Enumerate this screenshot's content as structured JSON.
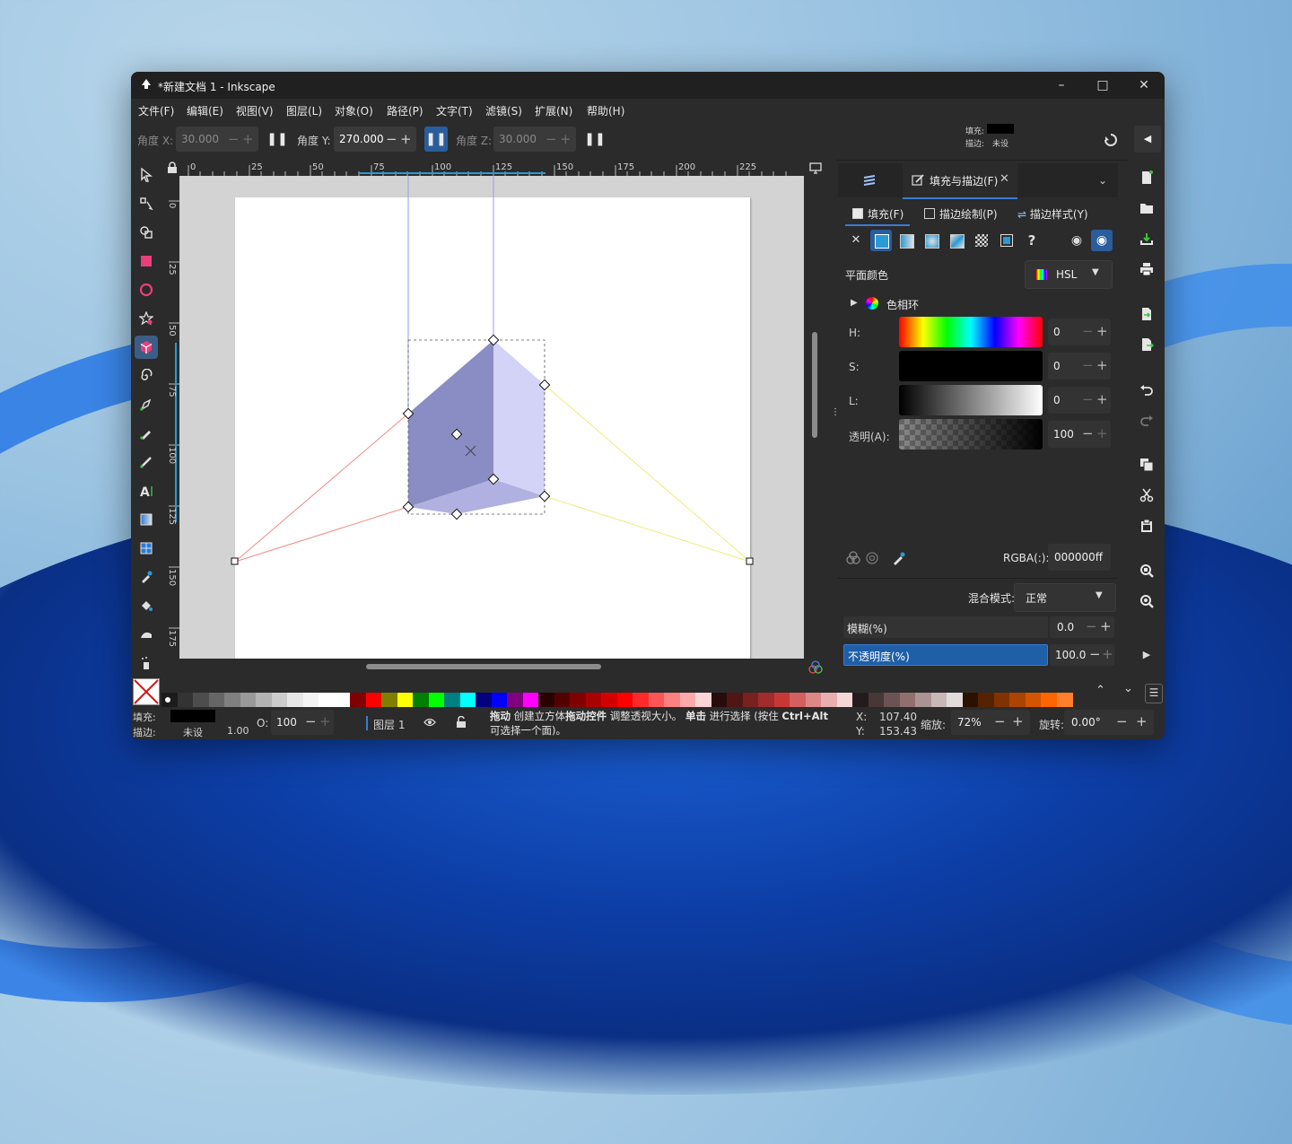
{
  "window": {
    "title": "*新建文档 1 - Inkscape"
  },
  "menu": [
    "文件(F)",
    "编辑(E)",
    "视图(V)",
    "图层(L)",
    "对象(O)",
    "路径(P)",
    "文字(T)",
    "滤镜(S)",
    "扩展(N)",
    "帮助(H)"
  ],
  "toolctl": {
    "angle_x_label": "角度 X:",
    "angle_x": "30.000",
    "angle_y_label": "角度 Y:",
    "angle_y": "270.000",
    "angle_z_label": "角度 Z:",
    "angle_z": "30.000",
    "fill_label": "填充:",
    "stroke_label": "描边:",
    "stroke_value": "未设"
  },
  "ruler": {
    "h": [
      "0",
      "25",
      "50",
      "75",
      "100",
      "125",
      "150",
      "175",
      "200",
      "225"
    ],
    "v": [
      "0",
      "25",
      "50",
      "75",
      "100",
      "125",
      "150",
      "175"
    ]
  },
  "panel": {
    "tab_label": "填充与描边(F)",
    "sub_fill": "填充(F)",
    "sub_stroke_paint": "描边绘制(P)",
    "sub_stroke_style": "描边样式(Y)",
    "flat_color": "平面颜色",
    "color_model": "HSL",
    "color_wheel": "色相环",
    "h_label": "H:",
    "h_value": "0",
    "s_label": "S:",
    "s_value": "0",
    "l_label": "L:",
    "l_value": "0",
    "a_label": "透明(A):",
    "a_value": "100",
    "rgba_label": "RGBA(:):",
    "rgba_value": "000000ff",
    "blend_label": "混合模式:",
    "blend_value": "正常",
    "blur_label": "模糊(%)",
    "blur_value": "0.0",
    "opacity_label": "不透明度(%)",
    "opacity_value": "100.0",
    "opacity_fraction": 1.0
  },
  "status": {
    "fill_label": "填充:",
    "stroke_label": "描边:",
    "stroke_value": "未设",
    "stroke_width": "1.00",
    "o_label": "O:",
    "o_value": "100",
    "layer": "图层 1",
    "msg_line1_b1": "拖动",
    "msg_line1_t1": " 创建立方体",
    "msg_line1_b2": "拖动控件",
    "msg_line1_t2": " 调整透视大小。 ",
    "msg_line1_b3": "单击",
    "msg_line1_t3": " 进行选择 (按住 ",
    "msg_line1_b4": "Ctrl+Alt",
    "msg_line2": "可选择一个面)。",
    "x_label": "X:",
    "x_value": "107.40",
    "y_label": "Y:",
    "y_value": "153.43",
    "zoom_label": "缩放:",
    "zoom_value": "72%",
    "rotate_label": "旋转:",
    "rotate_value": "0.00°"
  },
  "colors": {
    "accent": "#2a5d9c",
    "cube_left": "#8a8cc4",
    "cube_right": "#d2d3f7",
    "cube_bottom": "#b0b1e0",
    "palette": [
      "#1c1c1c",
      "#333333",
      "#4d4d4d",
      "#666666",
      "#808080",
      "#999999",
      "#b3b3b3",
      "#cccccc",
      "#e6e6e6",
      "#f2f2f2",
      "#ffffff",
      "#ffffff",
      "#800000",
      "#ff0000",
      "#808000",
      "#ffff00",
      "#008000",
      "#00ff00",
      "#008080",
      "#00ffff",
      "#000080",
      "#0000ff",
      "#800080",
      "#ff00ff",
      "#2b0000",
      "#550000",
      "#800000",
      "#aa0000",
      "#d40000",
      "#ff0000",
      "#ff2a2a",
      "#ff5555",
      "#ff8080",
      "#ffaaaa",
      "#ffd5d5",
      "#280b0b",
      "#501616",
      "#782121",
      "#a02c2c",
      "#c83737",
      "#d35f5f",
      "#de8787",
      "#e9afaf",
      "#f4d7d7",
      "#241c1c",
      "#483737",
      "#6c5353",
      "#916f6f",
      "#ac9393",
      "#c8b7b7",
      "#e3dbdb",
      "#2b1100",
      "#552200",
      "#803300",
      "#aa4400",
      "#d45500",
      "#ff6600",
      "#ff7f2a"
    ]
  }
}
